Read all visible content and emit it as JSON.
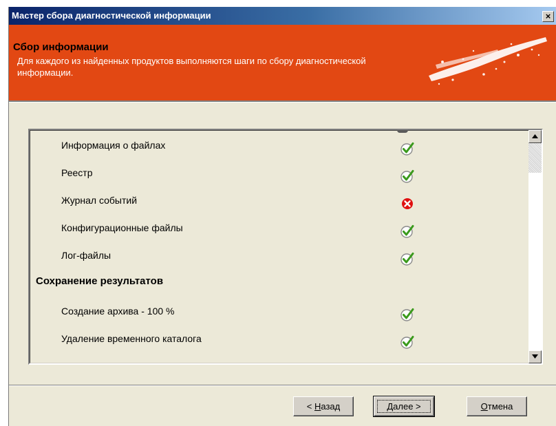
{
  "window": {
    "title": "Мастер сбора диагностической информации",
    "close_label": "×"
  },
  "header": {
    "title": "Сбор информации",
    "description": "Для каждого из найденных продуктов выполняются шаги по сбору диагностической информации.",
    "background_color": "#e24813",
    "logo_icon": "splash-logo-icon"
  },
  "list": {
    "items": [
      {
        "label": "Информация о файлах",
        "status": "success",
        "icon": "check-circle-icon"
      },
      {
        "label": "Реестр",
        "status": "success",
        "icon": "check-circle-icon"
      },
      {
        "label": "Журнал событий",
        "status": "error",
        "icon": "error-circle-icon"
      },
      {
        "label": "Конфигурационные файлы",
        "status": "success",
        "icon": "check-circle-icon"
      },
      {
        "label": "Лог-файлы",
        "status": "success",
        "icon": "check-circle-icon"
      }
    ],
    "section": "Сохранение результатов",
    "section_items": [
      {
        "label": "Создание архива - 100 %",
        "status": "success",
        "icon": "check-circle-icon"
      },
      {
        "label": "Удаление временного каталога",
        "status": "success",
        "icon": "check-circle-icon"
      }
    ]
  },
  "buttons": {
    "back_prefix": "< ",
    "back_hotkey": "Н",
    "back_rest": "азад",
    "next_hotkey": "Д",
    "next_rest": "алее >",
    "cancel_hotkey": "О",
    "cancel_rest": "тмена"
  },
  "colors": {
    "success": "#3a9a1c",
    "error": "#e01010"
  }
}
